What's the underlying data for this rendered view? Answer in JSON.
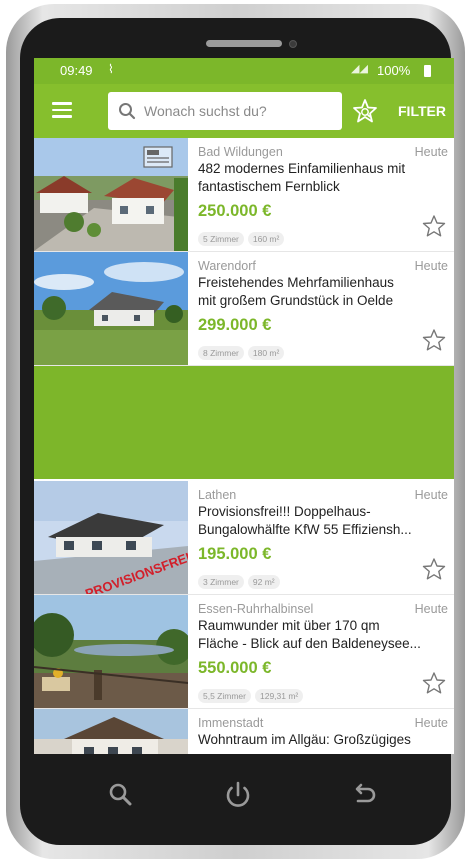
{
  "status_bar": {
    "time": "09:49",
    "battery": "100%"
  },
  "app_bar": {
    "search_placeholder": "Wonach suchst du?",
    "filter_label": "FILTER"
  },
  "listings": [
    {
      "location": "Bad Wildungen",
      "date": "Heute",
      "title_lines": [
        "482  modernes Einfamilienhaus mit",
        "fantastischem Fernblick"
      ],
      "price": "250.000 €",
      "tags": [
        "5 Zimmer",
        "160 m²"
      ]
    },
    {
      "location": "Warendorf",
      "date": "Heute",
      "title_lines": [
        "Freistehendes Mehrfamilienhaus",
        "mit großem Grundstück in Oelde"
      ],
      "price": "299.000 €",
      "tags": [
        "8 Zimmer",
        "180 m²"
      ]
    },
    {
      "location": "Lathen",
      "date": "Heute",
      "title_lines": [
        "Provisionsfrei!!!  Doppelhaus-",
        "Bungalowhälfte KfW 55 Effiziensh..."
      ],
      "price": "195.000 €",
      "tags": [
        "3 Zimmer",
        "92 m²"
      ],
      "image_overlay": "PROVISIONSFREI"
    },
    {
      "location": "Essen-Ruhrhalbinsel",
      "date": "Heute",
      "title_lines": [
        "Raumwunder mit über 170 qm",
        "Fläche - Blick auf den Baldeneysee..."
      ],
      "price": "550.000 €",
      "tags": [
        "5,5 Zimmer",
        "129,31 m²"
      ]
    },
    {
      "location": "Immenstadt",
      "date": "Heute",
      "title_lines": [
        "Wohntraum im Allgäu: Großzügiges",
        ""
      ],
      "price": "",
      "tags": []
    }
  ],
  "icons": {
    "menu": "hamburger-menu-icon",
    "search": "search-icon",
    "save_search": "star-search-icon",
    "favorite": "star-outline-icon",
    "gallery": "image-gallery-icon",
    "nav_search": "search-icon",
    "nav_power": "power-icon",
    "nav_back": "back-icon"
  },
  "colors": {
    "brand_green": "#86bf2d",
    "price_green": "#7cb72a",
    "ad_banner": "#7db62a"
  }
}
